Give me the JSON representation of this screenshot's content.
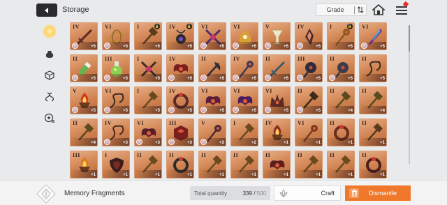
{
  "header": {
    "title": "Storage",
    "grade_label": "Grade"
  },
  "sidebar": {
    "items": [
      {
        "icon": "memory-fragment-icon",
        "active": true
      },
      {
        "icon": "pouch-icon",
        "active": false
      },
      {
        "icon": "cube-icon",
        "active": false
      },
      {
        "icon": "dna-icon",
        "active": false
      },
      {
        "icon": "disc-icon",
        "active": false
      }
    ]
  },
  "grid": {
    "items": [
      {
        "grade": "IV",
        "qty": "+5",
        "lock": false,
        "avatar": true,
        "art": "sword",
        "color": "#5a2a24"
      },
      {
        "grade": "VI",
        "qty": "+5",
        "lock": false,
        "avatar": true,
        "art": "hoops",
        "color": "#c28a35"
      },
      {
        "grade": "I",
        "qty": "+5",
        "lock": true,
        "avatar": false,
        "art": "hammer",
        "color": "#5a3d1d"
      },
      {
        "grade": "IV",
        "qty": "+5",
        "lock": true,
        "avatar": false,
        "art": "amulet",
        "color": "#2c2c2c"
      },
      {
        "grade": "VI",
        "qty": "+5",
        "lock": false,
        "avatar": true,
        "art": "cross",
        "color": "#4d2a6e"
      },
      {
        "grade": "VI",
        "qty": "+5",
        "lock": false,
        "avatar": true,
        "art": "claw",
        "color": "#d9a038"
      },
      {
        "grade": "V",
        "qty": "+5",
        "lock": false,
        "avatar": true,
        "art": "chalice",
        "color": "#f0e6c8"
      },
      {
        "grade": "IV",
        "qty": "+5",
        "lock": false,
        "avatar": true,
        "art": "shard",
        "color": "#4a2c2c"
      },
      {
        "grade": "I",
        "qty": "+5",
        "lock": true,
        "avatar": false,
        "art": "sceptre",
        "color": "#8a5a1e"
      },
      {
        "grade": "VI",
        "qty": "+5",
        "lock": false,
        "avatar": true,
        "art": "blade",
        "color": "#6a3a8a"
      },
      {
        "grade": "II",
        "qty": "+5",
        "lock": false,
        "avatar": true,
        "art": "vial",
        "color": "#69b24e"
      },
      {
        "grade": "III",
        "qty": "+5",
        "lock": false,
        "avatar": true,
        "art": "flask",
        "color": "#8fd050"
      },
      {
        "grade": "I",
        "qty": "+5",
        "lock": false,
        "avatar": false,
        "art": "cross",
        "color": "#3c2c24"
      },
      {
        "grade": "IV",
        "qty": "+5",
        "lock": false,
        "avatar": true,
        "art": "wings",
        "color": "#7a1e1e"
      },
      {
        "grade": "II",
        "qty": "+5",
        "lock": false,
        "avatar": true,
        "art": "axe",
        "color": "#2c2c3c"
      },
      {
        "grade": "IV",
        "qty": "+5",
        "lock": false,
        "avatar": true,
        "art": "sceptre",
        "color": "#3a3a5a"
      },
      {
        "grade": "II",
        "qty": "+5",
        "lock": false,
        "avatar": true,
        "art": "sword",
        "color": "#3c5a6a"
      },
      {
        "grade": "III",
        "qty": "+5",
        "lock": false,
        "avatar": true,
        "art": "mace",
        "color": "#2c2c3c"
      },
      {
        "grade": "II",
        "qty": "+5",
        "lock": false,
        "avatar": true,
        "art": "mace",
        "color": "#3c3c4c"
      },
      {
        "grade": "II",
        "qty": "+5",
        "lock": false,
        "avatar": false,
        "art": "whip",
        "color": "#3a2a1c"
      },
      {
        "grade": "V",
        "qty": "+5",
        "lock": false,
        "avatar": true,
        "art": "brazier",
        "color": "#d03a1e"
      },
      {
        "grade": "VI",
        "qty": "+5",
        "lock": false,
        "avatar": true,
        "art": "whip",
        "color": "#3c2c24"
      },
      {
        "grade": "I",
        "qty": "+5",
        "lock": false,
        "avatar": false,
        "art": "hammer",
        "color": "#6a4a1e"
      },
      {
        "grade": "IV",
        "qty": "+5",
        "lock": false,
        "avatar": true,
        "art": "ring",
        "color": "#5a2a2a"
      },
      {
        "grade": "VI",
        "qty": "+5",
        "lock": false,
        "avatar": true,
        "art": "wings",
        "color": "#5a1e3a"
      },
      {
        "grade": "VI",
        "qty": "+5",
        "lock": false,
        "avatar": true,
        "art": "wings",
        "color": "#4a1e5a"
      },
      {
        "grade": "VI",
        "qty": "+5",
        "lock": false,
        "avatar": true,
        "art": "crown",
        "color": "#5a2a24"
      },
      {
        "grade": "II",
        "qty": "+5",
        "lock": false,
        "avatar": true,
        "art": "hammer",
        "color": "#3a2a1c"
      },
      {
        "grade": "II",
        "qty": "+4",
        "lock": false,
        "avatar": false,
        "art": "hammer",
        "color": "#5a4a1e"
      },
      {
        "grade": "II",
        "qty": "+4",
        "lock": false,
        "avatar": false,
        "art": "hammer",
        "color": "#5a4a1e"
      },
      {
        "grade": "II",
        "qty": "+4",
        "lock": false,
        "avatar": false,
        "art": "hammer",
        "color": "#5a4a1e"
      },
      {
        "grade": "IV",
        "qty": "+3",
        "lock": false,
        "avatar": true,
        "art": "whip",
        "color": "#4a2a1c"
      },
      {
        "grade": "VI",
        "qty": "+3",
        "lock": false,
        "avatar": true,
        "art": "wings",
        "color": "#5a1e2a"
      },
      {
        "grade": "III",
        "qty": "+3",
        "lock": false,
        "avatar": true,
        "art": "cube",
        "color": "#7a1e1e"
      },
      {
        "grade": "V",
        "qty": "+3",
        "lock": false,
        "avatar": true,
        "art": "sceptre",
        "color": "#4a2a3a"
      },
      {
        "grade": "I",
        "qty": "+2",
        "lock": false,
        "avatar": false,
        "art": "hammer",
        "color": "#6a4a1e"
      },
      {
        "grade": "IV",
        "qty": "+1",
        "lock": false,
        "avatar": false,
        "art": "brazier",
        "color": "#8a2a1e"
      },
      {
        "grade": "VI",
        "qty": "+1",
        "lock": false,
        "avatar": false,
        "art": "sceptre",
        "color": "#7a3a1e"
      },
      {
        "grade": "II",
        "qty": "+1",
        "lock": false,
        "avatar": false,
        "art": "ring",
        "color": "#6a2a1e"
      },
      {
        "grade": "II",
        "qty": "+1",
        "lock": false,
        "avatar": false,
        "art": "hammer",
        "color": "#5a3a1e"
      },
      {
        "grade": "III",
        "qty": "+1",
        "lock": false,
        "avatar": false,
        "art": "brazier",
        "color": "#e07a1e"
      },
      {
        "grade": "I",
        "qty": "+1",
        "lock": false,
        "avatar": false,
        "art": "shield",
        "color": "#3a1e1e"
      },
      {
        "grade": "II",
        "qty": "+1",
        "lock": false,
        "avatar": false,
        "art": "hammer",
        "color": "#6a4a1e"
      },
      {
        "grade": "II",
        "qty": "+1",
        "lock": false,
        "avatar": false,
        "art": "ring",
        "color": "#2c2c2c"
      },
      {
        "grade": "II",
        "qty": "+1",
        "lock": false,
        "avatar": false,
        "art": "hammer",
        "color": "#6a4a1e"
      },
      {
        "grade": "II",
        "qty": "+1",
        "lock": false,
        "avatar": false,
        "art": "hammer",
        "color": "#6a4a1e"
      },
      {
        "grade": "II",
        "qty": "+1",
        "lock": false,
        "avatar": false,
        "art": "wings",
        "color": "#5a1e1e"
      },
      {
        "grade": "II",
        "qty": "+1",
        "lock": false,
        "avatar": false,
        "art": "hammer",
        "color": "#6a4a1e"
      },
      {
        "grade": "II",
        "qty": "+1",
        "lock": false,
        "avatar": false,
        "art": "hammer",
        "color": "#6a4a1e"
      },
      {
        "grade": "II",
        "qty": "+1",
        "lock": false,
        "avatar": false,
        "art": "ring",
        "color": "#4a1e1e"
      }
    ]
  },
  "footer": {
    "category_label": "Memory Fragments",
    "total_quantity_label": "Total quantity",
    "total_current": "339",
    "total_separator": " / ",
    "total_max": "500",
    "craft_label": "Craft",
    "dismantle_label": "Dismantle"
  },
  "colors": {
    "accent_orange": "#f0782a",
    "card_bg": "#cf8250",
    "notification_red": "#e5282c"
  }
}
